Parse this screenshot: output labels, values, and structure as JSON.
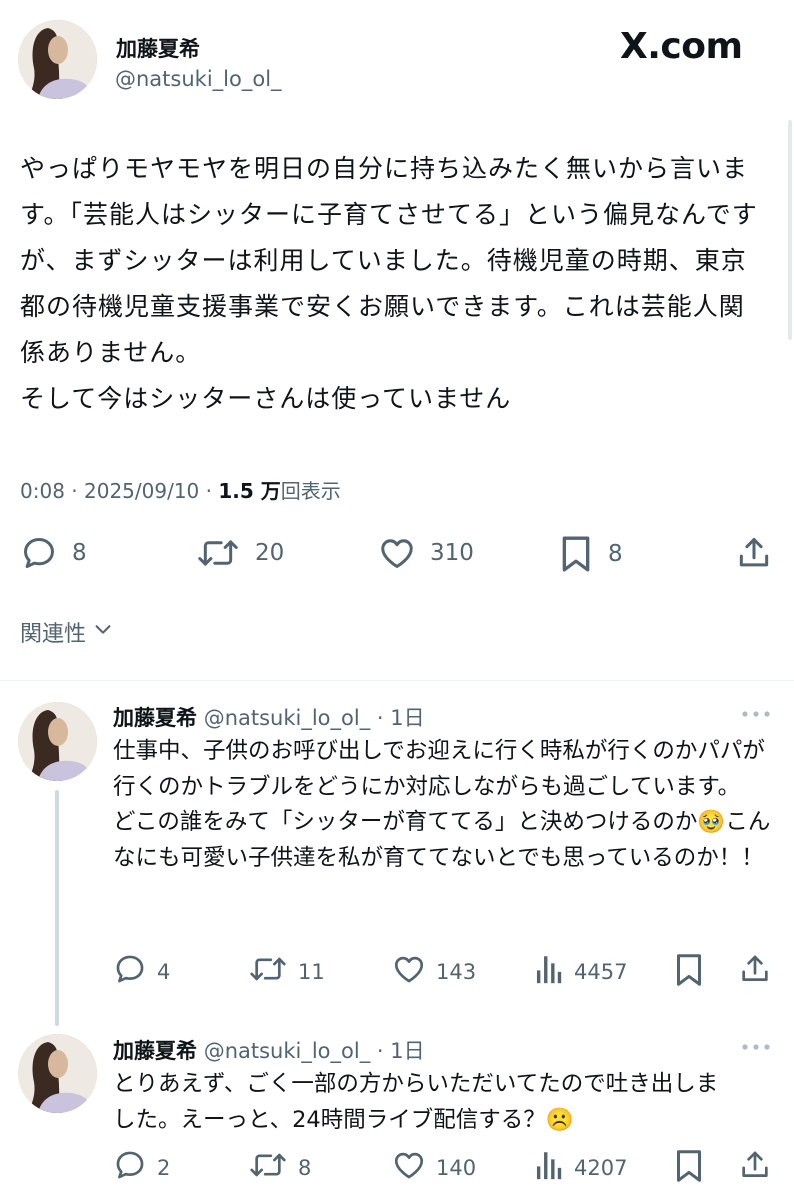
{
  "main_tweet": {
    "display_name": "加藤夏希",
    "handle": "@natsuki_lo_ol_",
    "brand": "X.com",
    "text": "やっぱりモヤモヤを明日の自分に持ち込みたく無いから言います。「芸能人はシッターに子育てさせてる」という偏見なんですが、まずシッターは利用していました。待機児童の時期、東京都の待機児童支援事業で安くお願いできます。これは芸能人関係ありません。\nそして今はシッターさんは使っていません",
    "time": "0:08",
    "date": "2025/09/10",
    "views_count": "1.5 万",
    "views_label": "回表示",
    "replies": "8",
    "reposts": "20",
    "likes": "310",
    "bookmarks": "8"
  },
  "related_label": "関連性",
  "replies": [
    {
      "display_name": "加藤夏希",
      "handle": "@natsuki_lo_ol_",
      "age": "1日",
      "text": "仕事中、子供のお呼び出しでお迎えに行く時私が行くのかパパが行くのかトラブルをどうにか対応しながらも過ごしています。\nどこの誰をみて「シッターが育ててる」と決めつけるのか🥹こんなにも可愛い子供達を私が育ててないとでも思っているのか！！",
      "replies": "4",
      "reposts": "11",
      "likes": "143",
      "views": "4457"
    },
    {
      "display_name": "加藤夏希",
      "handle": "@natsuki_lo_ol_",
      "age": "1日",
      "text": "とりあえず、ごく一部の方からいただいてたので吐き出しました。えーっと、24時間ライブ配信する？☹️",
      "replies": "2",
      "reposts": "8",
      "likes": "140",
      "views": "4207"
    }
  ]
}
